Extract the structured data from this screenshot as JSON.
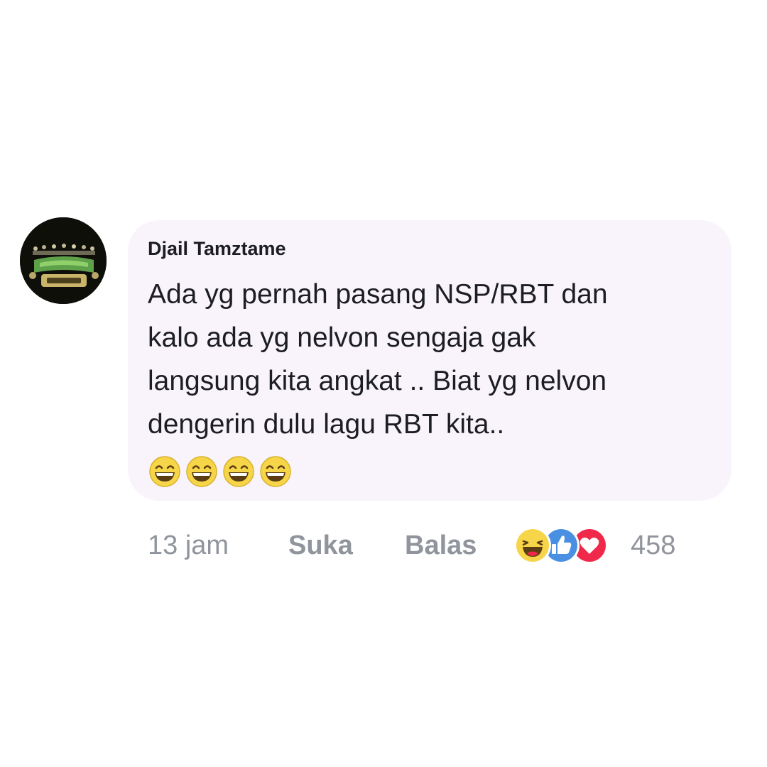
{
  "comment": {
    "author": "Djail Tamztame",
    "lines": [
      "Ada yg pernah pasang NSP/RBT dan",
      "kalo ada yg nelvon sengaja gak",
      "langsung kita angkat .. Biat yg nelvon",
      "dengerin dulu lagu RBT kita.."
    ],
    "emojis": [
      "laughing-emoji",
      "laughing-emoji",
      "laughing-emoji",
      "laughing-emoji"
    ],
    "timestamp": "13 jam",
    "like_label": "Suka",
    "reply_label": "Balas",
    "reaction_icons": [
      "haha-reaction-icon",
      "like-reaction-icon",
      "love-reaction-icon"
    ],
    "reaction_count": "458"
  },
  "colors": {
    "bubble_bg": "#f9f4fb",
    "text": "#1c1e21",
    "meta_text": "#90949c",
    "like_blue": "#4a90e2",
    "love_red": "#f0284a",
    "haha_yellow": "#f7d548"
  }
}
